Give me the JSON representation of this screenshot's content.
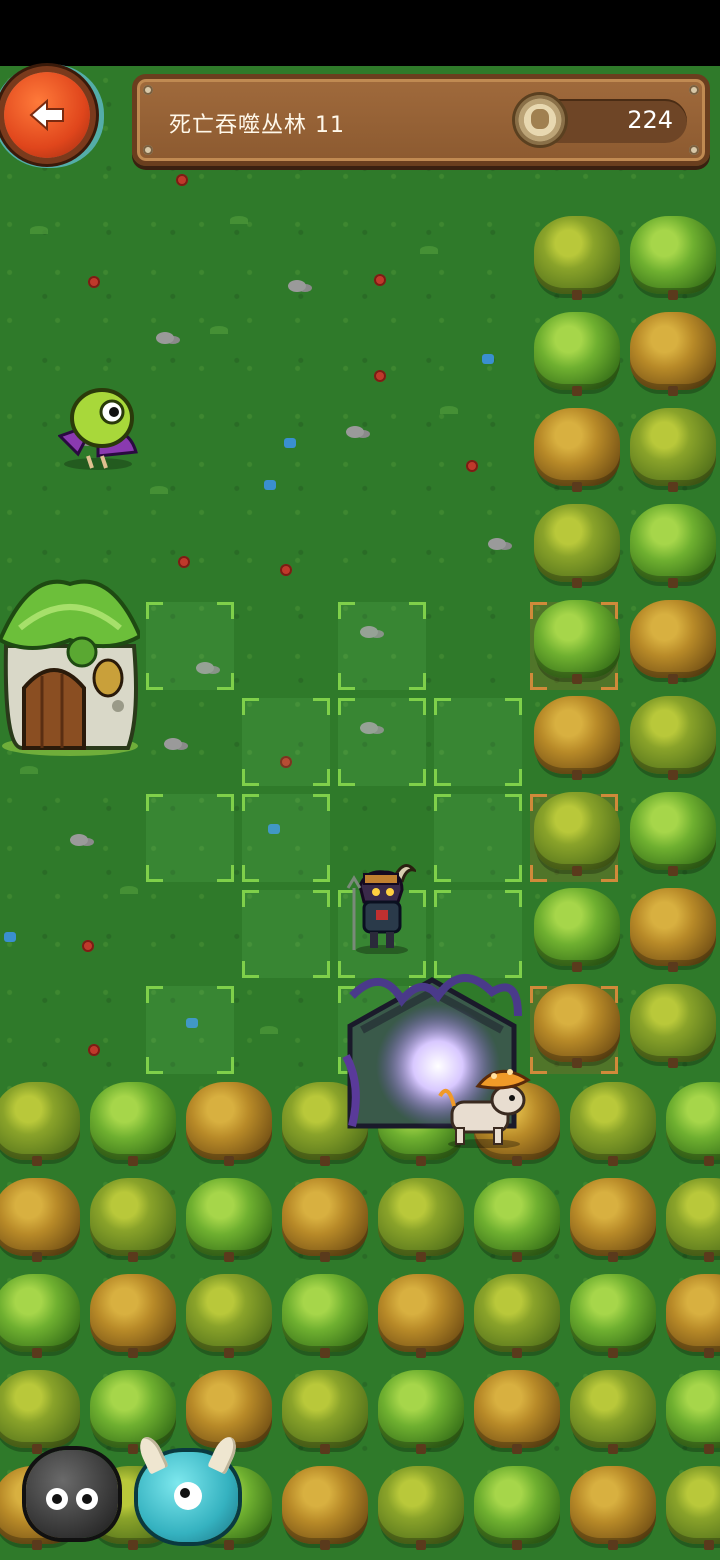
{
  "hud": {
    "back_icon": "left-arrow-icon",
    "level_title": "死亡吞噬丛林 11",
    "coin_icon": "coin-icon",
    "coins": "224"
  },
  "board": {
    "sprites": {
      "house": "mushroom-house",
      "portal": "dark-portal",
      "knight": "horned-knight",
      "cow": "mushroom-cow",
      "bird": "green-bird"
    }
  },
  "colors": {
    "grass": "#2f7a2a",
    "panel": "#8c5a30",
    "highlight_green": "#7fd04a",
    "highlight_orange": "#d08a3a"
  },
  "party": [
    {
      "name": "stone-creature-avatar"
    },
    {
      "name": "horned-creature-avatar"
    }
  ]
}
